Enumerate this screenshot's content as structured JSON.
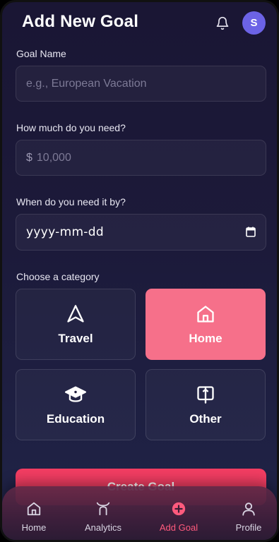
{
  "header": {
    "title": "Add New Goal",
    "avatar_initial": "S",
    "bell_icon": "bell-icon"
  },
  "form": {
    "goal_name": {
      "label": "Goal Name",
      "placeholder": "e.g., European Vacation",
      "value": ""
    },
    "amount": {
      "label": "How much do you need?",
      "prefix": "$",
      "placeholder": "10,000",
      "value": ""
    },
    "date": {
      "label": "When do you need it by?",
      "value": "yyyy-mm-dd",
      "icon": "calendar-icon"
    },
    "category": {
      "label": "Choose a category",
      "selected": "Home",
      "options": [
        {
          "label": "Travel",
          "icon": "navigation-arrow-icon"
        },
        {
          "label": "Home",
          "icon": "home-icon"
        },
        {
          "label": "Education",
          "icon": "graduation-cap-icon"
        },
        {
          "label": "Other",
          "icon": "book-icon"
        }
      ]
    }
  },
  "save_button": {
    "label": "Create Goal"
  },
  "nav": {
    "active": "Add Goal",
    "items": [
      {
        "label": "Home",
        "icon": "home-icon"
      },
      {
        "label": "Analytics",
        "icon": "analytics-icon"
      },
      {
        "label": "Add Goal",
        "icon": "plus-circle-icon"
      },
      {
        "label": "Profile",
        "icon": "user-icon"
      }
    ]
  },
  "colors": {
    "background": "#1c1a3a",
    "accent": "#f23d62",
    "selected_category": "#f6708a",
    "avatar": "#6c63e6",
    "nav_active": "#ff5a7d"
  }
}
